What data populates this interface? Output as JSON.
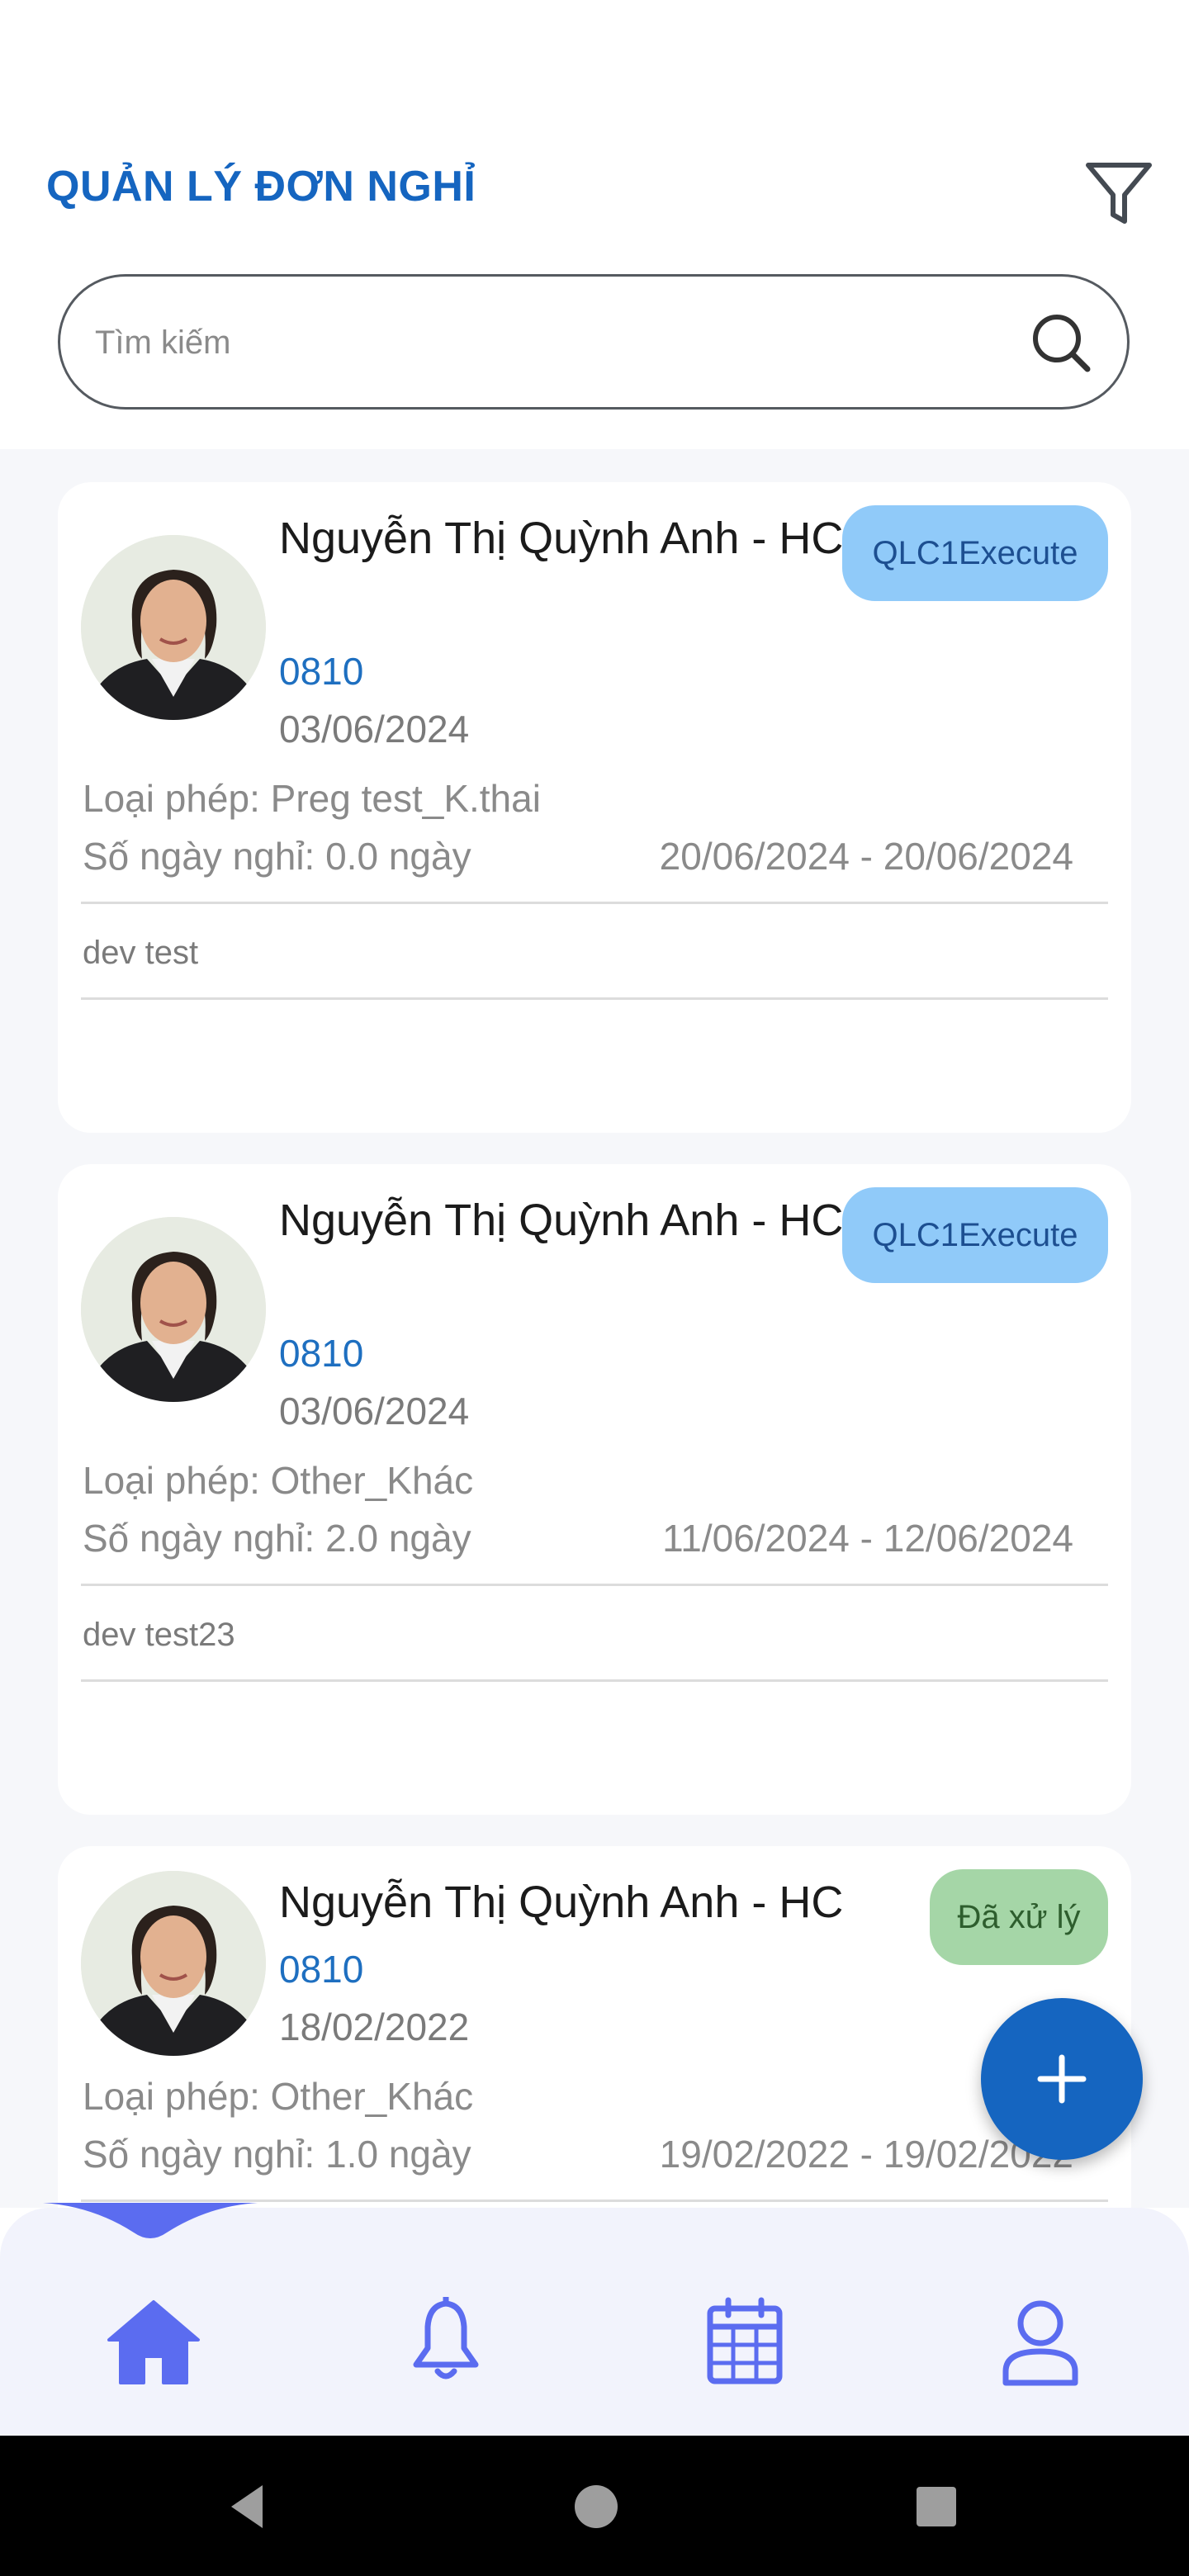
{
  "header": {
    "title": "QUẢN LÝ ĐƠN NGHỈ",
    "filter_icon": "filter-icon",
    "search": {
      "placeholder": "Tìm kiếm",
      "value": "",
      "icon": "search-icon"
    }
  },
  "requests": [
    {
      "name": "Nguyễn Thị Quỳnh Anh - HC",
      "code": "0810",
      "date": "03/06/2024",
      "status": "QLC1Execute",
      "status_color": "#90caf9",
      "leave_type": "Loại phép: Preg test_K.thai",
      "days": "Số ngày nghỉ: 0.0 ngày",
      "range": "20/06/2024 - 20/06/2024",
      "note": "dev test"
    },
    {
      "name": "Nguyễn Thị Quỳnh Anh - HC",
      "code": "0810",
      "date": "03/06/2024",
      "status": "QLC1Execute",
      "status_color": "#90caf9",
      "leave_type": "Loại phép: Other_Khác",
      "days": "Số ngày nghỉ: 2.0 ngày",
      "range": "11/06/2024 - 12/06/2024",
      "note": "dev test23"
    },
    {
      "name": "Nguyễn Thị Quỳnh Anh - HC",
      "code": "0810",
      "date": "18/02/2022",
      "status": "Đã xử lý",
      "status_color": "#a5d6a7",
      "leave_type": "Loại phép: Other_Khác",
      "days": "Số ngày nghỉ: 1.0 ngày",
      "range": "19/02/2022 - 19/02/2022",
      "note": ""
    }
  ],
  "fab": {
    "icon": "plus-icon"
  },
  "bottom_nav": {
    "items": [
      {
        "icon": "home-icon",
        "active": true
      },
      {
        "icon": "bell-icon",
        "active": false
      },
      {
        "icon": "calendar-icon",
        "active": false
      },
      {
        "icon": "user-icon",
        "active": false
      }
    ],
    "accent": "#5b6cf0"
  },
  "system_nav": {
    "icons": [
      "back-icon",
      "home-circle-icon",
      "recents-icon"
    ]
  }
}
